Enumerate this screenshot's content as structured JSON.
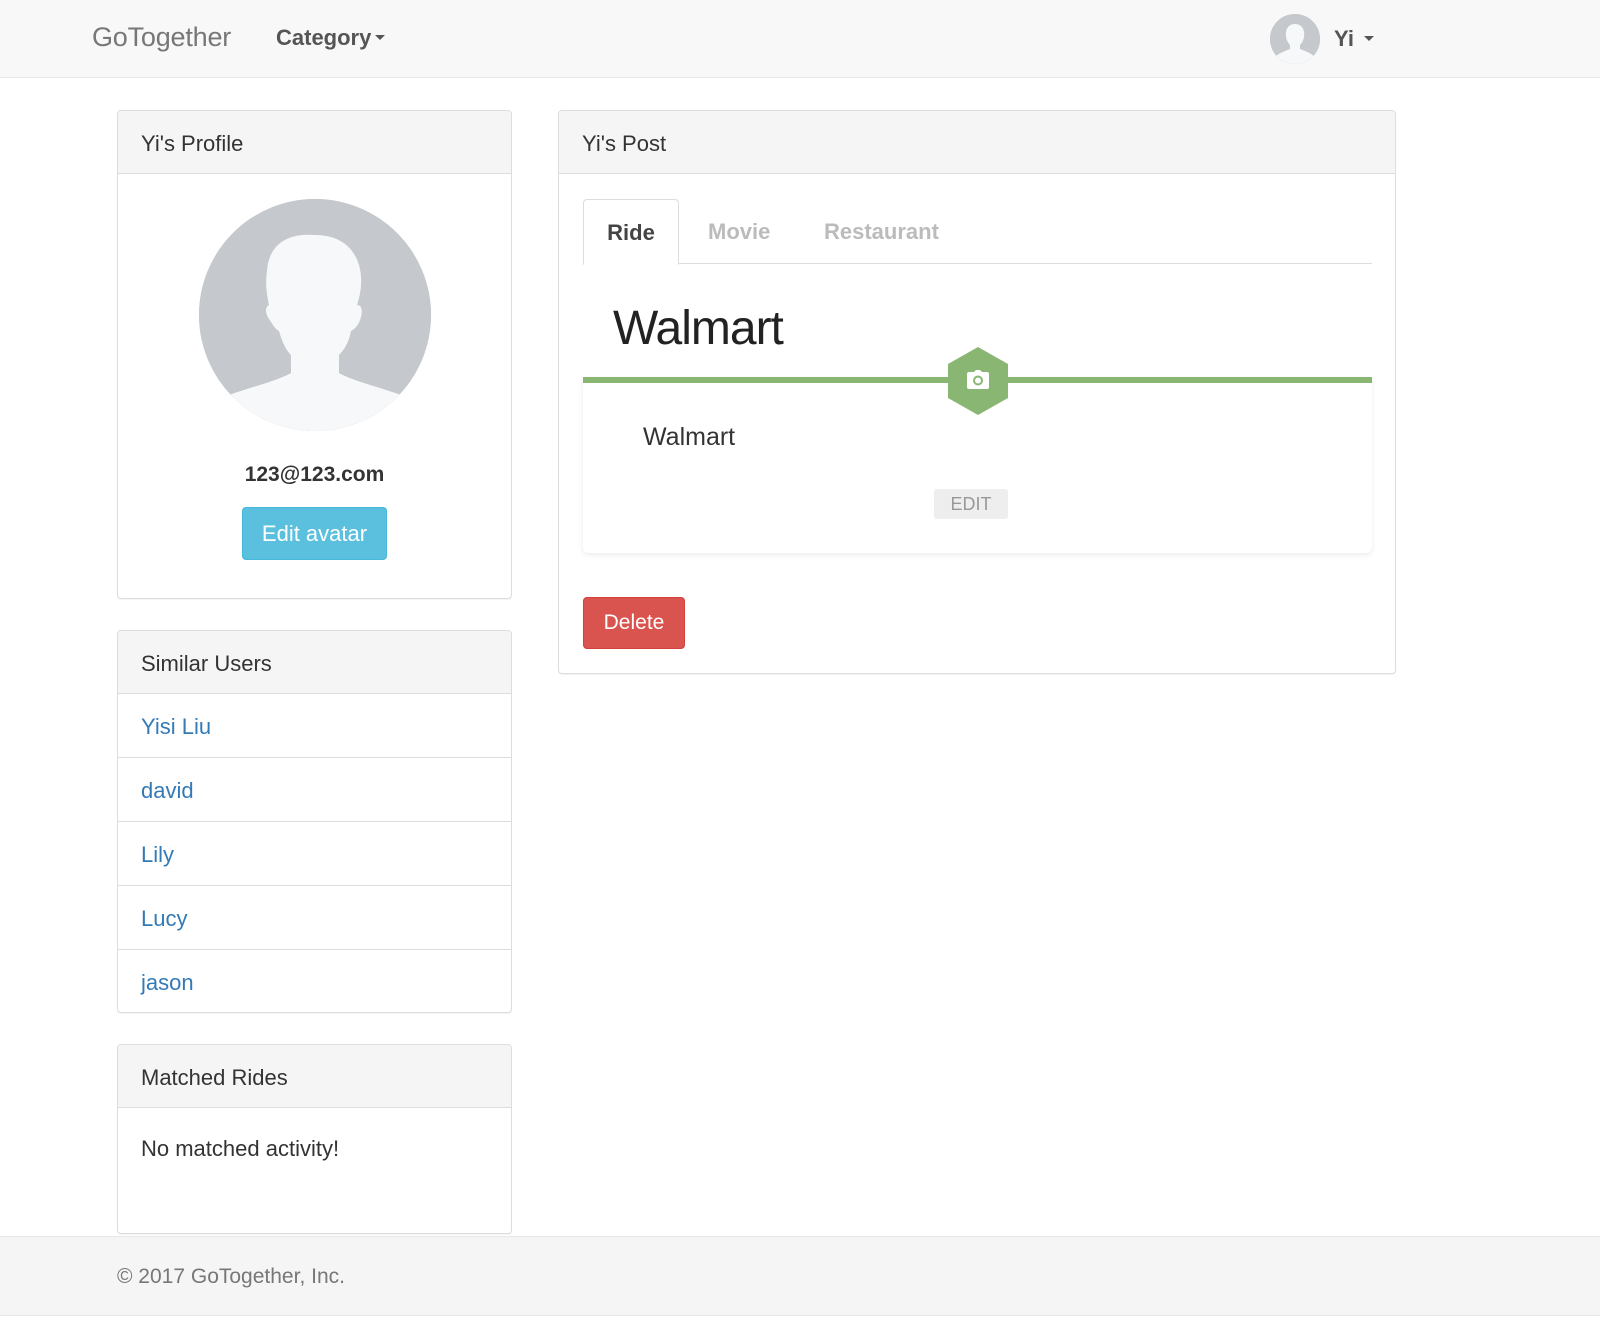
{
  "navbar": {
    "brand": "GoTogether",
    "category_label": "Category",
    "user_name": "Yi",
    "avatar_icon": "default-avatar-icon"
  },
  "profile": {
    "heading": "Yi's Profile",
    "email": "123@123.com",
    "edit_avatar_label": "Edit avatar"
  },
  "similar_users": {
    "heading": "Similar Users",
    "items": [
      "Yisi Liu",
      "david",
      "Lily",
      "Lucy",
      "jason"
    ]
  },
  "matched_rides": {
    "heading": "Matched Rides",
    "empty_text": "No matched activity!"
  },
  "post": {
    "heading": "Yi's Post",
    "tabs": [
      {
        "label": "Ride",
        "active": true
      },
      {
        "label": "Movie",
        "active": false
      },
      {
        "label": "Restaurant",
        "active": false
      }
    ],
    "title": "Walmart",
    "card_text": "Walmart",
    "card_icon": "camera-icon",
    "edit_label": "EDIT",
    "delete_label": "Delete"
  },
  "footer": {
    "text": "© 2017 GoTogether, Inc."
  },
  "colors": {
    "accent_green": "#8ab674",
    "info_button": "#5bc0de",
    "danger_button": "#d9534f",
    "link": "#337ab7"
  }
}
